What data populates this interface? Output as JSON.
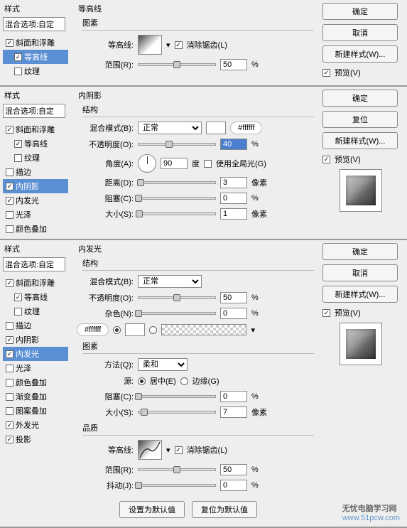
{
  "section1": {
    "styles_title": "样式",
    "blend_label": "混合选项:自定",
    "items": [
      {
        "label": "斜面和浮雕",
        "checked": true,
        "level": 1,
        "sel": false
      },
      {
        "label": "等高线",
        "checked": true,
        "level": 2,
        "sel": true
      },
      {
        "label": "纹理",
        "checked": false,
        "level": 2,
        "sel": false
      }
    ],
    "panel_title": "等高线",
    "group_title": "图素",
    "contour_label": "等高线:",
    "antialias_label": "消除锯齿(L)",
    "range_label": "范围(R):",
    "range_value": "50",
    "range_unit": "%",
    "buttons": {
      "ok": "确定",
      "cancel": "取消",
      "new": "新建样式(W)...",
      "preview": "预览(V)"
    }
  },
  "section2": {
    "styles_title": "样式",
    "blend_label": "混合选项:自定",
    "items": [
      {
        "label": "斜面和浮雕",
        "checked": true,
        "level": 1,
        "sel": false
      },
      {
        "label": "等高线",
        "checked": true,
        "level": 2,
        "sel": false
      },
      {
        "label": "纹理",
        "checked": false,
        "level": 2,
        "sel": false
      },
      {
        "label": "描边",
        "checked": false,
        "level": 1,
        "sel": false
      },
      {
        "label": "内阴影",
        "checked": true,
        "level": 1,
        "sel": true
      },
      {
        "label": "内发光",
        "checked": true,
        "level": 1,
        "sel": false
      },
      {
        "label": "光泽",
        "checked": false,
        "level": 1,
        "sel": false
      },
      {
        "label": "颜色叠加",
        "checked": false,
        "level": 1,
        "sel": false
      }
    ],
    "panel_title": "内阴影",
    "group_title": "结构",
    "blendmode_label": "混合模式(B):",
    "blendmode_value": "正常",
    "color_hex": "#ffffff",
    "opacity_label": "不透明度(O):",
    "opacity_value": "40",
    "opacity_unit": "%",
    "angle_label": "角度(A):",
    "angle_value": "90",
    "angle_unit": "度",
    "global_label": "使用全局光(G)",
    "distance_label": "距离(D):",
    "distance_value": "3",
    "distance_unit": "像素",
    "choke_label": "阻塞(C):",
    "choke_value": "0",
    "choke_unit": "%",
    "size_label": "大小(S):",
    "size_value": "1",
    "size_unit": "像素",
    "buttons": {
      "ok": "确定",
      "reset": "复位",
      "new": "新建样式(W)...",
      "preview": "预览(V)"
    }
  },
  "section3": {
    "styles_title": "样式",
    "blend_label": "混合选项:自定",
    "items": [
      {
        "label": "斜面和浮雕",
        "checked": true,
        "level": 1,
        "sel": false
      },
      {
        "label": "等高线",
        "checked": true,
        "level": 2,
        "sel": false
      },
      {
        "label": "纹理",
        "checked": false,
        "level": 2,
        "sel": false
      },
      {
        "label": "描边",
        "checked": false,
        "level": 1,
        "sel": false
      },
      {
        "label": "内阴影",
        "checked": true,
        "level": 1,
        "sel": false
      },
      {
        "label": "内发光",
        "checked": true,
        "level": 1,
        "sel": true
      },
      {
        "label": "光泽",
        "checked": false,
        "level": 1,
        "sel": false
      },
      {
        "label": "颜色叠加",
        "checked": false,
        "level": 1,
        "sel": false
      },
      {
        "label": "渐变叠加",
        "checked": false,
        "level": 1,
        "sel": false
      },
      {
        "label": "图案叠加",
        "checked": false,
        "level": 1,
        "sel": false
      },
      {
        "label": "外发光",
        "checked": true,
        "level": 1,
        "sel": false
      },
      {
        "label": "投影",
        "checked": true,
        "level": 1,
        "sel": false
      }
    ],
    "panel_title": "内发光",
    "group_structure": "结构",
    "blendmode_label": "混合模式(B):",
    "blendmode_value": "正常",
    "opacity_label": "不透明度(O):",
    "opacity_value": "50",
    "opacity_unit": "%",
    "noise_label": "杂色(N):",
    "noise_value": "0",
    "noise_unit": "%",
    "color_hex": "#ffffff",
    "group_elements": "图素",
    "technique_label": "方法(Q):",
    "technique_value": "柔和",
    "source_label": "源:",
    "source_center": "居中(E)",
    "source_edge": "边缘(G)",
    "choke_label": "阻塞(C):",
    "choke_value": "0",
    "choke_unit": "%",
    "size_label": "大小(S):",
    "size_value": "7",
    "size_unit": "像素",
    "group_quality": "品质",
    "contour_label": "等高线:",
    "antialias_label": "消除锯齿(L)",
    "range_label": "范围(R):",
    "range_value": "50",
    "range_unit": "%",
    "jitter_label": "抖动(J):",
    "jitter_value": "0",
    "jitter_unit": "%",
    "btn_default": "设置为默认值",
    "btn_reset_default": "复位为默认值",
    "buttons": {
      "ok": "确定",
      "cancel": "取消",
      "new": "新建样式(W)...",
      "preview": "预览(V)"
    },
    "watermark": "无忧电脑学习网",
    "watermark_url": "www.51pcw.com"
  }
}
